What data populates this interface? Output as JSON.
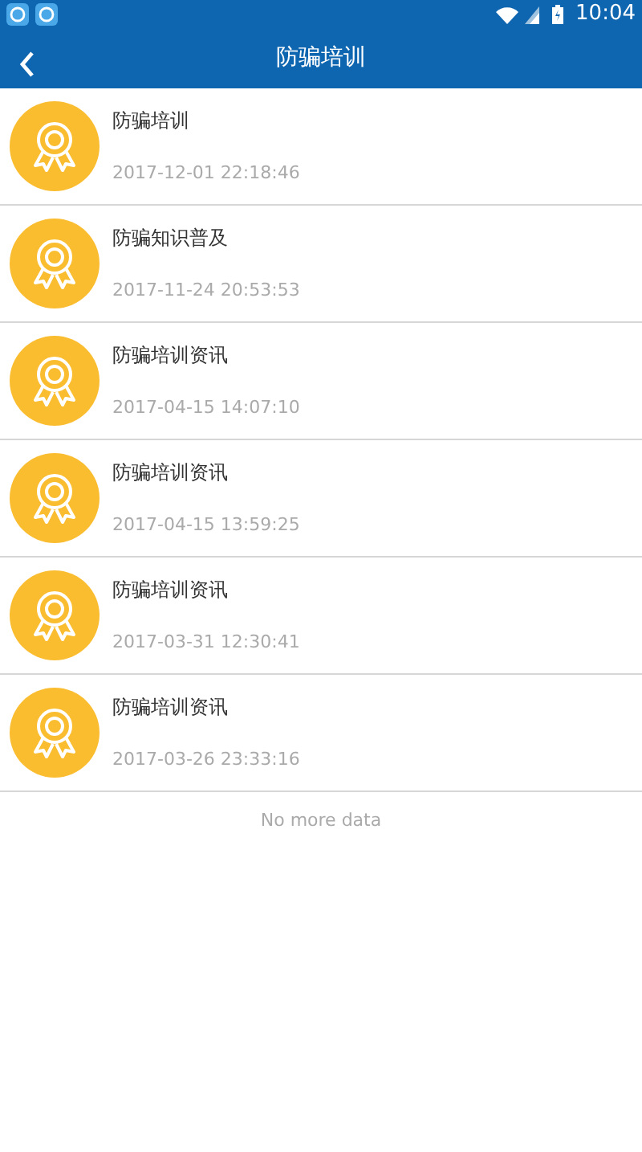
{
  "status_bar": {
    "time": "10:04"
  },
  "header": {
    "title": "防骗培训"
  },
  "items": [
    {
      "title": "防骗培训",
      "date": "2017-12-01 22:18:46"
    },
    {
      "title": "防骗知识普及",
      "date": "2017-11-24 20:53:53"
    },
    {
      "title": "防骗培训资讯",
      "date": "2017-04-15 14:07:10"
    },
    {
      "title": "防骗培训资讯",
      "date": "2017-04-15 13:59:25"
    },
    {
      "title": "防骗培训资讯",
      "date": "2017-03-31 12:30:41"
    },
    {
      "title": "防骗培训资讯",
      "date": "2017-03-26 23:33:16"
    }
  ],
  "footer": "No more data"
}
